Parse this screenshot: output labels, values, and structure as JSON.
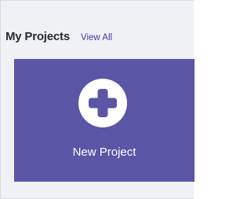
{
  "header": {
    "title": "My Projects",
    "view_all_label": "View All"
  },
  "new_project_card": {
    "label": "New Project",
    "icon": "plus-circle-icon"
  },
  "colors": {
    "card_background": "#5b55a6",
    "link": "#3d3aa6",
    "panel_background": "#eff1f4"
  }
}
